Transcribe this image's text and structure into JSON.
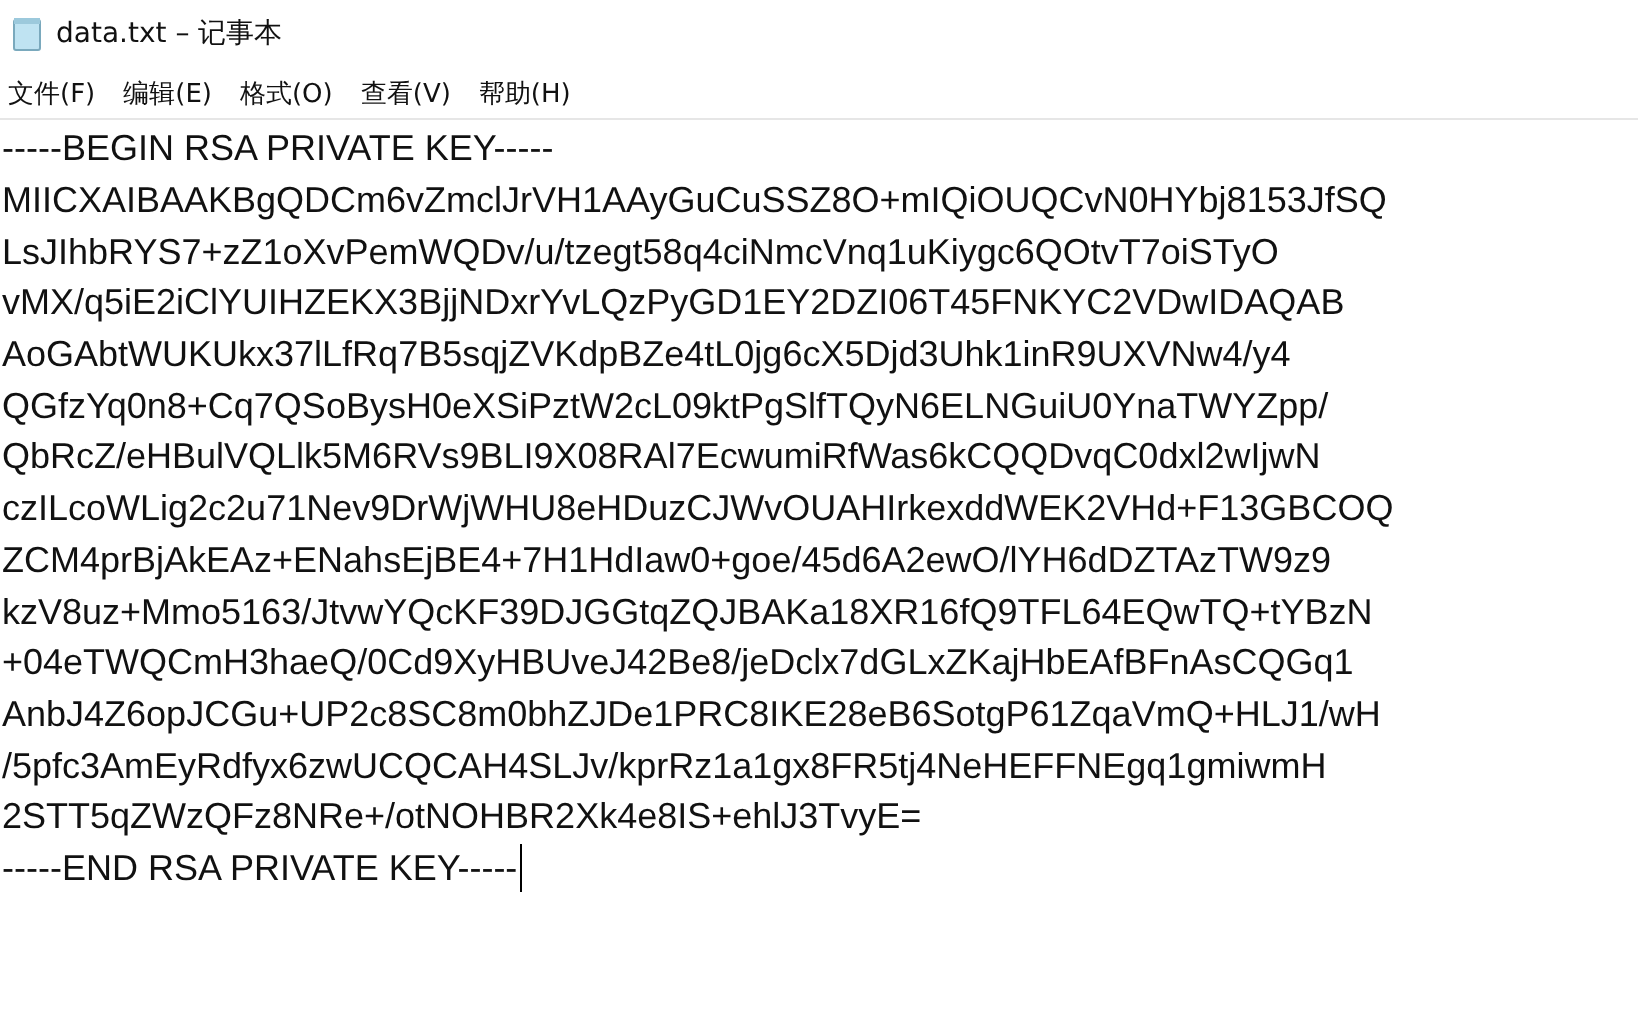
{
  "window": {
    "title": "data.txt – 记事本"
  },
  "menu": [
    "文件(F)",
    "编辑(E)",
    "格式(O)",
    "查看(V)",
    "帮助(H)"
  ],
  "editor": {
    "lines": [
      "-----BEGIN RSA PRIVATE KEY-----",
      "MIICXAIBAAKBgQDCm6vZmclJrVH1AAyGuCuSSZ8O+mIQiOUQCvN0HYbj8153JfSQ",
      "LsJIhbRYS7+zZ1oXvPemWQDv/u/tzegt58q4ciNmcVnq1uKiygc6QOtvT7oiSTyO",
      "vMX/q5iE2iClYUIHZEKX3BjjNDxrYvLQzPyGD1EY2DZI06T45FNKYC2VDwIDAQAB",
      "AoGAbtWUKUkx37lLfRq7B5sqjZVKdpBZe4tL0jg6cX5Djd3Uhk1inR9UXVNw4/y4",
      "QGfzYq0n8+Cq7QSoBysH0eXSiPztW2cL09ktPgSlfTQyN6ELNGuiU0YnaTWYZpp/",
      "QbRcZ/eHBulVQLlk5M6RVs9BLI9X08RAl7EcwumiRfWas6kCQQDvqC0dxl2wIjwN",
      "czILcoWLig2c2u71Nev9DrWjWHU8eHDuzCJWvOUAHIrkexddWEK2VHd+F13GBCOQ",
      "ZCM4prBjAkEAz+ENahsEjBE4+7H1HdIaw0+goe/45d6A2ewO/lYH6dDZTAzTW9z9",
      "kzV8uz+Mmo5163/JtvwYQcKF39DJGGtqZQJBAKa18XR16fQ9TFL64EQwTQ+tYBzN",
      "+04eTWQCmH3haeQ/0Cd9XyHBUveJ42Be8/jeDclx7dGLxZKajHbEAfBFnAsCQGq1",
      "AnbJ4Z6opJCGu+UP2c8SC8m0bhZJDe1PRC8IKE28eB6SotgP61ZqaVmQ+HLJ1/wH",
      "/5pfc3AmEyRdfyx6zwUCQCAH4SLJv/kprRz1a1gx8FR5tj4NeHEFFNEgq1gmiwmH",
      "2STT5qZWzQFz8NRe+/otNOHBR2Xk4e8IS+ehlJ3TvyE=",
      "-----END RSA PRIVATE KEY-----"
    ]
  }
}
